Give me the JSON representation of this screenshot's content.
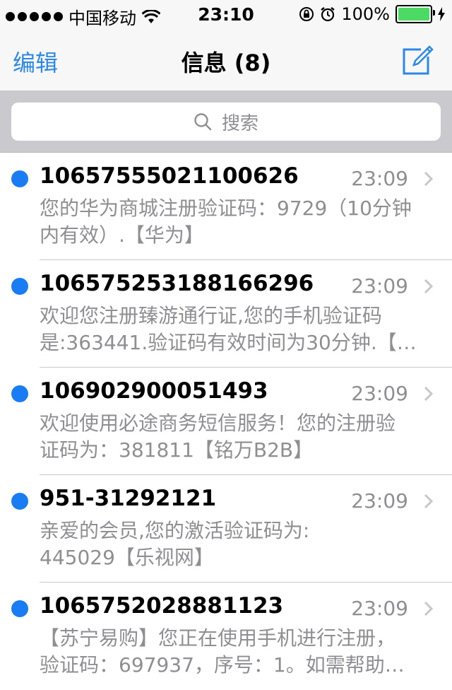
{
  "status_bar": {
    "carrier": "中国移动",
    "time": "23:10",
    "battery": "100%"
  },
  "nav": {
    "edit_label": "编辑",
    "title": "信息 (8)"
  },
  "search": {
    "placeholder": "搜索"
  },
  "messages": [
    {
      "sender": "10657555021100626",
      "time": "23:09",
      "preview_line1": "您的华为商城注册验证码：9729（10分钟",
      "preview_line2": "内有效）.【华为】"
    },
    {
      "sender": "106575253188166296",
      "time": "23:09",
      "preview_line1": "欢迎您注册臻游通行证,您的手机验证码",
      "preview_line2": "是:363441.验证码有效时间为30分钟.【…"
    },
    {
      "sender": "106902900051493",
      "time": "23:09",
      "preview_line1": "欢迎使用必途商务短信服务！您的注册验",
      "preview_line2": "证码为：381811【铭万B2B】"
    },
    {
      "sender": "951-31292121",
      "time": "23:09",
      "preview_line1": "亲爱的会员,您的激活验证码为:",
      "preview_line2": "445029【乐视网】"
    },
    {
      "sender": "1065752028881123",
      "time": "23:09",
      "preview_line1": "【苏宁易购】您正在使用手机进行注册，",
      "preview_line2": "验证码：697937，序号：1。如需帮助…"
    }
  ],
  "colors": {
    "accent": "#2b88e6",
    "unread_dot": "#1a7cf2",
    "battery": "#4cd964"
  }
}
